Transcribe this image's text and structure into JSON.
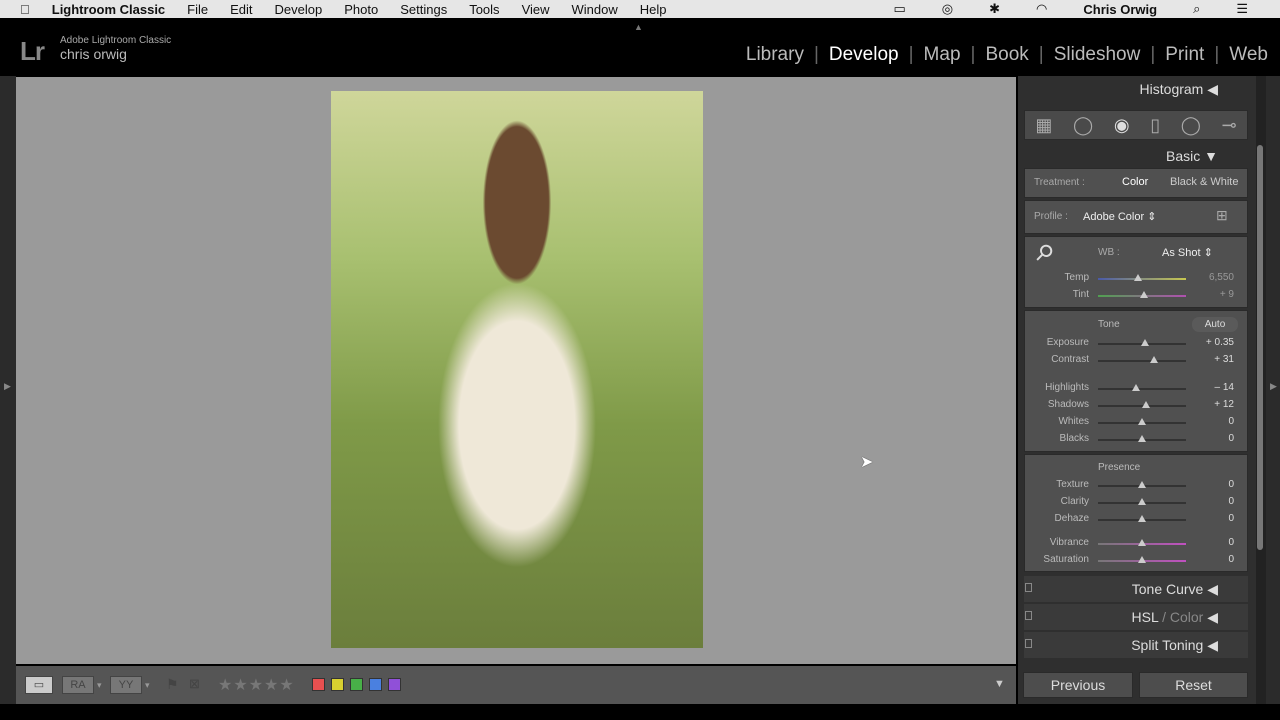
{
  "menubar": {
    "app": "Lightroom Classic",
    "items": [
      "File",
      "Edit",
      "Develop",
      "Photo",
      "Settings",
      "Tools",
      "View",
      "Window",
      "Help"
    ],
    "user": "Chris Orwig"
  },
  "identity": {
    "logo": "Lr",
    "line1": "Adobe Lightroom Classic",
    "line2": "chris orwig"
  },
  "modules": [
    "Library",
    "Develop",
    "Map",
    "Book",
    "Slideshow",
    "Print",
    "Web"
  ],
  "active_module": "Develop",
  "panels": {
    "histogram": "Histogram",
    "basic": "Basic",
    "tone_curve": "Tone Curve",
    "hsl": "HSL",
    "color": "/ Color",
    "split_toning": "Split Toning"
  },
  "basic": {
    "treatment_label": "Treatment :",
    "treatment_color": "Color",
    "treatment_bw": "Black & White",
    "profile_label": "Profile :",
    "profile_value": "Adobe Color",
    "wb_label": "WB :",
    "wb_value": "As Shot",
    "tone_label": "Tone",
    "auto": "Auto",
    "presence_label": "Presence",
    "sliders": [
      {
        "label": "Temp",
        "value": "6,550",
        "pos": 0.45
      },
      {
        "label": "Tint",
        "value": "+ 9",
        "pos": 0.52
      },
      {
        "label": "Exposure",
        "value": "+ 0.35",
        "pos": 0.53
      },
      {
        "label": "Contrast",
        "value": "+ 31",
        "pos": 0.64
      },
      {
        "label": "Highlights",
        "value": "– 14",
        "pos": 0.43
      },
      {
        "label": "Shadows",
        "value": "+ 12",
        "pos": 0.55
      },
      {
        "label": "Whites",
        "value": "0",
        "pos": 0.5
      },
      {
        "label": "Blacks",
        "value": "0",
        "pos": 0.5
      },
      {
        "label": "Texture",
        "value": "0",
        "pos": 0.5
      },
      {
        "label": "Clarity",
        "value": "0",
        "pos": 0.5
      },
      {
        "label": "Dehaze",
        "value": "0",
        "pos": 0.5
      },
      {
        "label": "Vibrance",
        "value": "0",
        "pos": 0.5
      },
      {
        "label": "Saturation",
        "value": "0",
        "pos": 0.5
      }
    ]
  },
  "toolbar": {
    "ra": "RA",
    "yy": "YY",
    "stars": "★★★★★",
    "labels": [
      "#e85050",
      "#d8d030",
      "#48b048",
      "#4a80e0",
      "#9050d8"
    ]
  },
  "buttons": {
    "previous": "Previous",
    "reset": "Reset"
  }
}
